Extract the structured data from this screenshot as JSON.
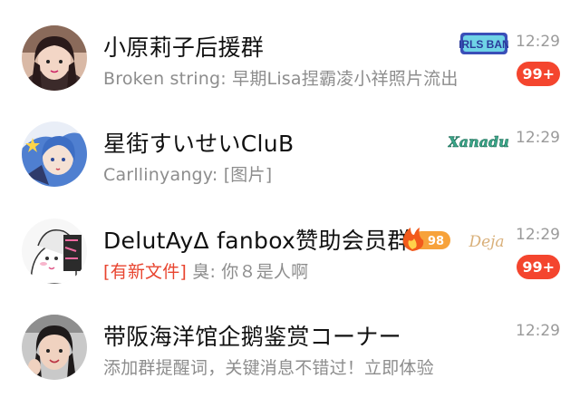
{
  "chats": [
    {
      "title": "小原莉子后援群",
      "preview": "Broken  string: 早期Lisa捏霸凌小祥照片流出",
      "time": "12:29",
      "unread": "99+",
      "logo_text": "GIRLS BAND"
    },
    {
      "title": "星街すいせいCluB",
      "preview": "Carllinyangy: [图片]",
      "time": "12:29",
      "logo_text": "Xanadu"
    },
    {
      "title": "DelutAyΔ fanbox赞助会员群",
      "level": "98",
      "preview_tag": "[有新文件]",
      "preview": " 臭: 你８是人啊",
      "time": "12:29",
      "unread": "99+",
      "logo_text": "Deja"
    },
    {
      "title": "带阪海洋馆企鹅鉴赏コーナー",
      "preview": "添加群提醒词，关键消息不错过！立即体验",
      "time": "12:29"
    }
  ],
  "colors": {
    "badge": "#f4452e",
    "tag": "#e8442f",
    "title": "#111111",
    "preview": "#8d8d8d",
    "time": "#9a9a9a"
  }
}
